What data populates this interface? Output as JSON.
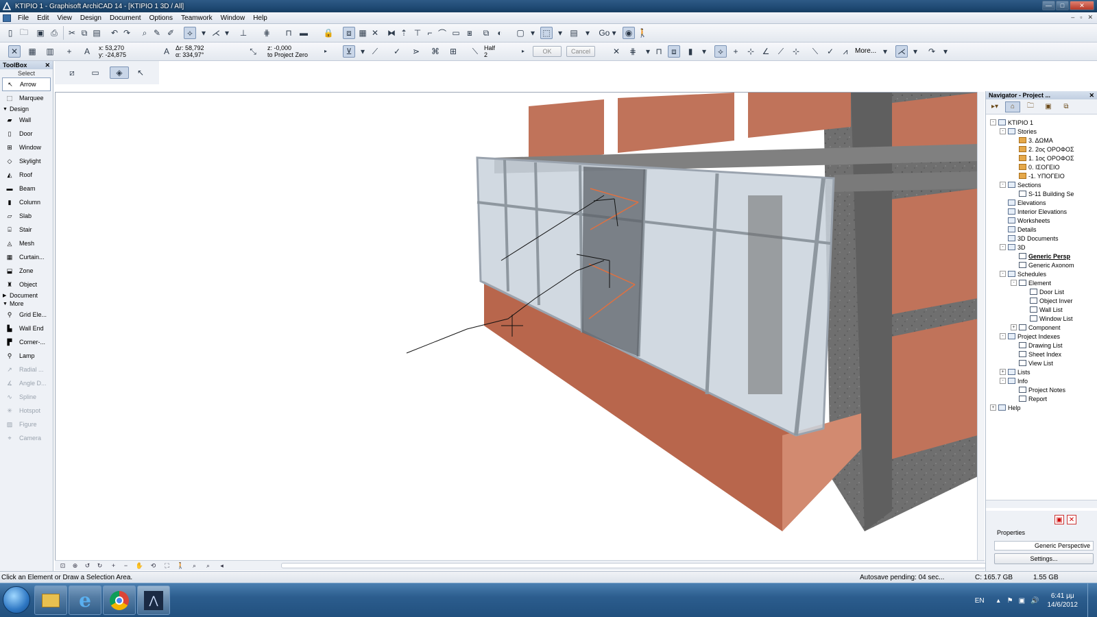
{
  "window": {
    "title": "ΚΤΙΡΙΟ 1 - Graphisoft ArchiCAD 14 - [ΚΤΙΡΙΟ 1 3D / All]"
  },
  "menu": [
    "File",
    "Edit",
    "View",
    "Design",
    "Document",
    "Options",
    "Teamwork",
    "Window",
    "Help"
  ],
  "coords": {
    "x": "x: 53,270",
    "y": "y: -24,875",
    "dr": "Δr: 58,792",
    "angle": "α: 334,97°",
    "z": "z: -0,000",
    "z_ref": "to Project Zero",
    "half_label": "Half",
    "half_value": "2"
  },
  "buttons": {
    "ok": "OK",
    "cancel": "Cancel",
    "more": "More..."
  },
  "toolbox": {
    "title": "ToolBox",
    "select_label": "Select",
    "select_tools": [
      "Arrow",
      "Marquee"
    ],
    "design_label": "Design",
    "design_tools": [
      "Wall",
      "Door",
      "Window",
      "Skylight",
      "Roof",
      "Beam",
      "Column",
      "Slab",
      "Stair",
      "Mesh",
      "Curtain...",
      "Zone",
      "Object"
    ],
    "document_label": "Document",
    "more_label": "More",
    "more_tools_enabled": [
      "Grid Ele...",
      "Wall End",
      "Corner-...",
      "Lamp"
    ],
    "more_tools_disabled": [
      "Radial ...",
      "Angle D...",
      "Spline",
      "Hotspot",
      "Figure",
      "Camera"
    ]
  },
  "navigator": {
    "title": "Navigator - Project ...",
    "tree": [
      {
        "label": "ΚΤΙΡΙΟ 1",
        "level": 0,
        "expander": "-"
      },
      {
        "label": "Stories",
        "level": 1,
        "expander": "-"
      },
      {
        "label": "3. ΔΩΜΑ",
        "level": 2
      },
      {
        "label": "2. 2ος ΟΡΟΦΟΣ",
        "level": 2
      },
      {
        "label": "1. 1ος ΟΡΟΦΟΣ",
        "level": 2
      },
      {
        "label": "0. ΙΣΟΓΕΙΟ",
        "level": 2
      },
      {
        "label": "-1. ΥΠΟΓΕΙΟ",
        "level": 2
      },
      {
        "label": "Sections",
        "level": 1,
        "expander": "-"
      },
      {
        "label": "S-11 Building Se",
        "level": 2
      },
      {
        "label": "Elevations",
        "level": 1
      },
      {
        "label": "Interior Elevations",
        "level": 1
      },
      {
        "label": "Worksheets",
        "level": 1
      },
      {
        "label": "Details",
        "level": 1
      },
      {
        "label": "3D Documents",
        "level": 1
      },
      {
        "label": "3D",
        "level": 1,
        "expander": "-"
      },
      {
        "label": "Generic Persp",
        "level": 2,
        "highlight": true
      },
      {
        "label": "Generic Axonom",
        "level": 2
      },
      {
        "label": "Schedules",
        "level": 1,
        "expander": "-"
      },
      {
        "label": "Element",
        "level": 2,
        "expander": "-"
      },
      {
        "label": "Door List",
        "level": 3
      },
      {
        "label": "Object Inver",
        "level": 3
      },
      {
        "label": "Wall List",
        "level": 3
      },
      {
        "label": "Window List",
        "level": 3
      },
      {
        "label": "Component",
        "level": 2,
        "expander": "+"
      },
      {
        "label": "Project Indexes",
        "level": 1,
        "expander": "-"
      },
      {
        "label": "Drawing List",
        "level": 2
      },
      {
        "label": "Sheet Index",
        "level": 2
      },
      {
        "label": "View List",
        "level": 2
      },
      {
        "label": "Lists",
        "level": 1,
        "expander": "+"
      },
      {
        "label": "Info",
        "level": 1,
        "expander": "-"
      },
      {
        "label": "Project Notes",
        "level": 2
      },
      {
        "label": "Report",
        "level": 2
      },
      {
        "label": "Help",
        "level": 0,
        "expander": "+"
      }
    ],
    "properties_label": "Properties",
    "properties_value": "Generic Perspective",
    "settings_button": "Settings..."
  },
  "status": {
    "message": "Click an Element or Draw a Selection Area.",
    "autosave": "Autosave pending: 04 sec...",
    "disk": "C: 165.7 GB",
    "ram": "1.55 GB"
  },
  "taskbar": {
    "lang": "EN",
    "time": "6:41 μμ",
    "date": "14/6/2012"
  },
  "colors": {
    "brick": "#c0735a",
    "concrete": "#6e6e6e",
    "glass": "#c9d2dc",
    "selection_blue": "#c9d6e8"
  }
}
